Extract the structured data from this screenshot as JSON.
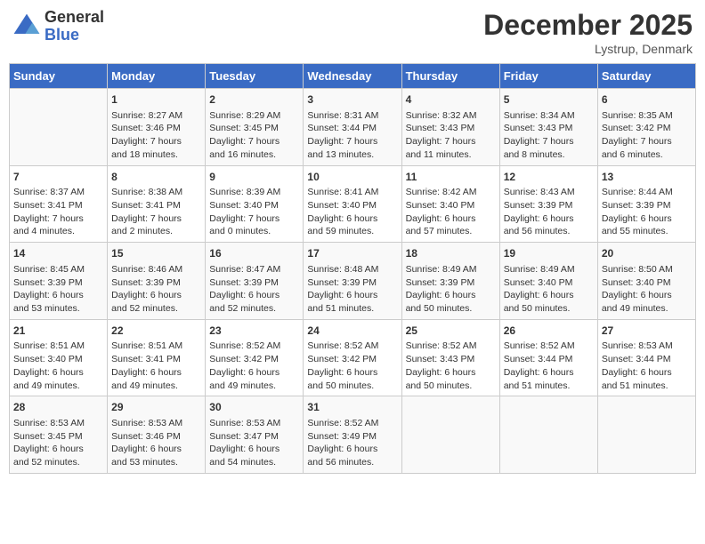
{
  "header": {
    "logo_line1": "General",
    "logo_line2": "Blue",
    "month": "December 2025",
    "location": "Lystrup, Denmark"
  },
  "weekdays": [
    "Sunday",
    "Monday",
    "Tuesday",
    "Wednesday",
    "Thursday",
    "Friday",
    "Saturday"
  ],
  "weeks": [
    [
      {
        "day": "",
        "content": ""
      },
      {
        "day": "1",
        "content": "Sunrise: 8:27 AM\nSunset: 3:46 PM\nDaylight: 7 hours\nand 18 minutes."
      },
      {
        "day": "2",
        "content": "Sunrise: 8:29 AM\nSunset: 3:45 PM\nDaylight: 7 hours\nand 16 minutes."
      },
      {
        "day": "3",
        "content": "Sunrise: 8:31 AM\nSunset: 3:44 PM\nDaylight: 7 hours\nand 13 minutes."
      },
      {
        "day": "4",
        "content": "Sunrise: 8:32 AM\nSunset: 3:43 PM\nDaylight: 7 hours\nand 11 minutes."
      },
      {
        "day": "5",
        "content": "Sunrise: 8:34 AM\nSunset: 3:43 PM\nDaylight: 7 hours\nand 8 minutes."
      },
      {
        "day": "6",
        "content": "Sunrise: 8:35 AM\nSunset: 3:42 PM\nDaylight: 7 hours\nand 6 minutes."
      }
    ],
    [
      {
        "day": "7",
        "content": "Sunrise: 8:37 AM\nSunset: 3:41 PM\nDaylight: 7 hours\nand 4 minutes."
      },
      {
        "day": "8",
        "content": "Sunrise: 8:38 AM\nSunset: 3:41 PM\nDaylight: 7 hours\nand 2 minutes."
      },
      {
        "day": "9",
        "content": "Sunrise: 8:39 AM\nSunset: 3:40 PM\nDaylight: 7 hours\nand 0 minutes."
      },
      {
        "day": "10",
        "content": "Sunrise: 8:41 AM\nSunset: 3:40 PM\nDaylight: 6 hours\nand 59 minutes."
      },
      {
        "day": "11",
        "content": "Sunrise: 8:42 AM\nSunset: 3:40 PM\nDaylight: 6 hours\nand 57 minutes."
      },
      {
        "day": "12",
        "content": "Sunrise: 8:43 AM\nSunset: 3:39 PM\nDaylight: 6 hours\nand 56 minutes."
      },
      {
        "day": "13",
        "content": "Sunrise: 8:44 AM\nSunset: 3:39 PM\nDaylight: 6 hours\nand 55 minutes."
      }
    ],
    [
      {
        "day": "14",
        "content": "Sunrise: 8:45 AM\nSunset: 3:39 PM\nDaylight: 6 hours\nand 53 minutes."
      },
      {
        "day": "15",
        "content": "Sunrise: 8:46 AM\nSunset: 3:39 PM\nDaylight: 6 hours\nand 52 minutes."
      },
      {
        "day": "16",
        "content": "Sunrise: 8:47 AM\nSunset: 3:39 PM\nDaylight: 6 hours\nand 52 minutes."
      },
      {
        "day": "17",
        "content": "Sunrise: 8:48 AM\nSunset: 3:39 PM\nDaylight: 6 hours\nand 51 minutes."
      },
      {
        "day": "18",
        "content": "Sunrise: 8:49 AM\nSunset: 3:39 PM\nDaylight: 6 hours\nand 50 minutes."
      },
      {
        "day": "19",
        "content": "Sunrise: 8:49 AM\nSunset: 3:40 PM\nDaylight: 6 hours\nand 50 minutes."
      },
      {
        "day": "20",
        "content": "Sunrise: 8:50 AM\nSunset: 3:40 PM\nDaylight: 6 hours\nand 49 minutes."
      }
    ],
    [
      {
        "day": "21",
        "content": "Sunrise: 8:51 AM\nSunset: 3:40 PM\nDaylight: 6 hours\nand 49 minutes."
      },
      {
        "day": "22",
        "content": "Sunrise: 8:51 AM\nSunset: 3:41 PM\nDaylight: 6 hours\nand 49 minutes."
      },
      {
        "day": "23",
        "content": "Sunrise: 8:52 AM\nSunset: 3:42 PM\nDaylight: 6 hours\nand 49 minutes."
      },
      {
        "day": "24",
        "content": "Sunrise: 8:52 AM\nSunset: 3:42 PM\nDaylight: 6 hours\nand 50 minutes."
      },
      {
        "day": "25",
        "content": "Sunrise: 8:52 AM\nSunset: 3:43 PM\nDaylight: 6 hours\nand 50 minutes."
      },
      {
        "day": "26",
        "content": "Sunrise: 8:52 AM\nSunset: 3:44 PM\nDaylight: 6 hours\nand 51 minutes."
      },
      {
        "day": "27",
        "content": "Sunrise: 8:53 AM\nSunset: 3:44 PM\nDaylight: 6 hours\nand 51 minutes."
      }
    ],
    [
      {
        "day": "28",
        "content": "Sunrise: 8:53 AM\nSunset: 3:45 PM\nDaylight: 6 hours\nand 52 minutes."
      },
      {
        "day": "29",
        "content": "Sunrise: 8:53 AM\nSunset: 3:46 PM\nDaylight: 6 hours\nand 53 minutes."
      },
      {
        "day": "30",
        "content": "Sunrise: 8:53 AM\nSunset: 3:47 PM\nDaylight: 6 hours\nand 54 minutes."
      },
      {
        "day": "31",
        "content": "Sunrise: 8:52 AM\nSunset: 3:49 PM\nDaylight: 6 hours\nand 56 minutes."
      },
      {
        "day": "",
        "content": ""
      },
      {
        "day": "",
        "content": ""
      },
      {
        "day": "",
        "content": ""
      }
    ]
  ]
}
